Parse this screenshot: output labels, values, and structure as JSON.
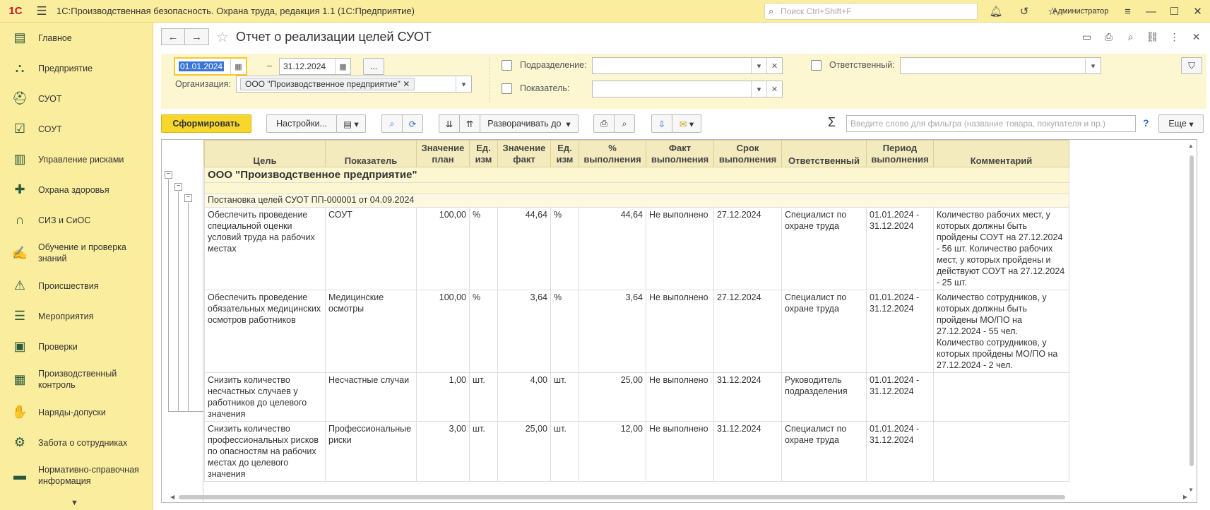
{
  "app": {
    "logo": "1С",
    "title": "1С:Производственная безопасность. Охрана труда, редакция 1.1  (1С:Предприятие)",
    "search_placeholder": "Поиск Ctrl+Shift+F",
    "user": "Администратор"
  },
  "sidebar": {
    "items": [
      {
        "label": "Главное",
        "icon": "home-icon"
      },
      {
        "label": "Предприятие",
        "icon": "org-structure-icon"
      },
      {
        "label": "СУОТ",
        "icon": "worker-helmet-icon"
      },
      {
        "label": "СОУТ",
        "icon": "checklist-icon"
      },
      {
        "label": "Управление рисками",
        "icon": "risk-chart-icon"
      },
      {
        "label": "Охрана здоровья",
        "icon": "medical-cross-icon"
      },
      {
        "label": "СИЗ и СиОС",
        "icon": "headphones-icon"
      },
      {
        "label": "Обучение и проверка знаний",
        "icon": "training-icon"
      },
      {
        "label": "Происшествия",
        "icon": "warning-icon"
      },
      {
        "label": "Мероприятия",
        "icon": "list-doc-icon"
      },
      {
        "label": "Проверки",
        "icon": "clipboard-icon"
      },
      {
        "label": "Производственный контроль",
        "icon": "control-chart-icon"
      },
      {
        "label": "Наряды-допуски",
        "icon": "permit-icon"
      },
      {
        "label": "Забота о сотрудниках",
        "icon": "gear-people-icon"
      },
      {
        "label": "Нормативно-справочная информация",
        "icon": "reference-book-icon"
      }
    ]
  },
  "header": {
    "title": "Отчет о реализации целей СУОТ"
  },
  "filters": {
    "date_from": "01.01.2024",
    "date_sep": "–",
    "date_to": "31.12.2024",
    "more_btn": "...",
    "org_label": "Организация:",
    "org_value": "ООО \"Производственное предприятие\"",
    "subdivision_label": "Подразделение:",
    "indicator_label": "Показатель:",
    "responsible_label": "Ответственный:"
  },
  "toolbar": {
    "generate": "Сформировать",
    "settings": "Настройки...",
    "expand": "Разворачивать до",
    "filter_placeholder": "Введите слово для фильтра (название товара, покупателя и пр.)",
    "help": "?",
    "more": "Еще"
  },
  "table": {
    "headers": [
      "Цель",
      "Показатель",
      "Значение план",
      "Ед. изм",
      "Значение факт",
      "Ед. изм",
      "% выполнения",
      "Факт выполнения",
      "Срок выполнения",
      "Ответственный",
      "Период выполнения",
      "Комментарий"
    ],
    "group1": "ООО \"Производственное предприятие\"",
    "group2": "Постановка целей СУОТ ПП-000001 от 04.09.2024",
    "rows": [
      {
        "goal": "Обеспечить проведение специальной оценки условий труда на рабочих местах",
        "indicator": "СОУТ",
        "plan": "100,00",
        "unit1": "%",
        "fact": "44,64",
        "unit2": "%",
        "percent": "44,64",
        "status": "Не выполнено",
        "deadline": "27.12.2024",
        "responsible": "Специалист по охране труда",
        "period": "01.01.2024 - 31.12.2024",
        "comment": "Количество рабочих мест, у которых должны быть пройдены СОУТ на 27.12.2024 - 56 шт. Количество рабочих мест, у которых пройдены и действуют СОУТ на 27.12.2024 - 25 шт."
      },
      {
        "goal": "Обеспечить проведение обязательных медицинских осмотров работников",
        "indicator": "Медицинские осмотры",
        "plan": "100,00",
        "unit1": "%",
        "fact": "3,64",
        "unit2": "%",
        "percent": "3,64",
        "status": "Не выполнено",
        "deadline": "27.12.2024",
        "responsible": "Специалист по охране труда",
        "period": "01.01.2024 - 31.12.2024",
        "comment": "Количество сотрудников, у которых должны быть пройдены МО/ПО на 27.12.2024 - 55 чел. Количество сотрудников, у которых пройдены МО/ПО на 27.12.2024 - 2 чел."
      },
      {
        "goal": "Снизить количество несчастных случаев у работников до целевого значения",
        "indicator": "Несчастные случаи",
        "plan": "1,00",
        "unit1": "шт.",
        "fact": "4,00",
        "unit2": "шт.",
        "percent": "25,00",
        "status": "Не выполнено",
        "deadline": "31.12.2024",
        "responsible": "Руководитель подразделения",
        "period": "01.01.2024 - 31.12.2024",
        "comment": ""
      },
      {
        "goal": "Снизить количество профессиональных рисков по опасностям на рабочих местах до целевого значения",
        "indicator": "Профессиональные риски",
        "plan": "3,00",
        "unit1": "шт.",
        "fact": "25,00",
        "unit2": "шт.",
        "percent": "12,00",
        "status": "Не выполнено",
        "deadline": "31.12.2024",
        "responsible": "Специалист по охране труда",
        "period": "01.01.2024 - 31.12.2024",
        "comment": ""
      }
    ]
  },
  "colors": {
    "accent_yellow": "#fbed9e",
    "button_yellow": "#f8d72d",
    "header_bg": "#f3ebbd"
  }
}
